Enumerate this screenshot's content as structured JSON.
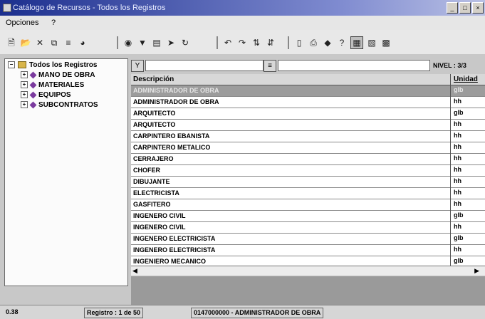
{
  "window": {
    "title": "Catálogo de Recursos - Todos los Registros",
    "controls": [
      "_",
      "□",
      "×"
    ]
  },
  "menubar": {
    "items": [
      "Opciones",
      "?"
    ]
  },
  "toolbar": {
    "icons": [
      "new-doc-icon",
      "open-icon",
      "delete-icon",
      "copy-icon",
      "filter-icon",
      "chart-icon",
      "binoculars-icon",
      "funnel-icon",
      "print-preview-icon",
      "export-icon",
      "refresh-icon",
      "undo-icon",
      "redo-icon",
      "sort-asc-icon",
      "sort-desc-icon",
      "page-icon",
      "printer-icon",
      "diamond-icon",
      "help-icon",
      "group-icon",
      "grid-icon",
      "save-icon"
    ]
  },
  "tree": {
    "root": "Todos los Registros",
    "children": [
      "MANO DE OBRA",
      "MATERIALES",
      "EQUIPOS",
      "SUBCONTRATOS"
    ]
  },
  "filter": {
    "nivel_label": "NIVEL : 3/3"
  },
  "grid": {
    "columns": [
      "Descripción",
      "Unidad"
    ],
    "rows": [
      {
        "desc": "ADMINISTRADOR DE OBRA",
        "unit": "glb"
      },
      {
        "desc": "ADMINISTRADOR DE OBRA",
        "unit": "hh"
      },
      {
        "desc": "ARQUITECTO",
        "unit": "glb"
      },
      {
        "desc": "ARQUITECTO",
        "unit": "hh"
      },
      {
        "desc": "CARPINTERO EBANISTA",
        "unit": "hh"
      },
      {
        "desc": "CARPINTERO METALICO",
        "unit": "hh"
      },
      {
        "desc": "CERRAJERO",
        "unit": "hh"
      },
      {
        "desc": "CHOFER",
        "unit": "hh"
      },
      {
        "desc": "DIBUJANTE",
        "unit": "hh"
      },
      {
        "desc": "ELECTRICISTA",
        "unit": "hh"
      },
      {
        "desc": "GASFITERO",
        "unit": "hh"
      },
      {
        "desc": "INGENERO CIVIL",
        "unit": "glb"
      },
      {
        "desc": "INGENERO CIVIL",
        "unit": "hh"
      },
      {
        "desc": "INGENERO ELECTRICISTA",
        "unit": "glb"
      },
      {
        "desc": "INGENERO ELECTRICISTA",
        "unit": "hh"
      },
      {
        "desc": "INGENIERO MECANICO",
        "unit": "glb"
      }
    ]
  },
  "statusbar": {
    "left": "0.38",
    "registro": "Registro : 1 de 50",
    "current": "0147000000 - ADMINISTRADOR DE OBRA"
  }
}
